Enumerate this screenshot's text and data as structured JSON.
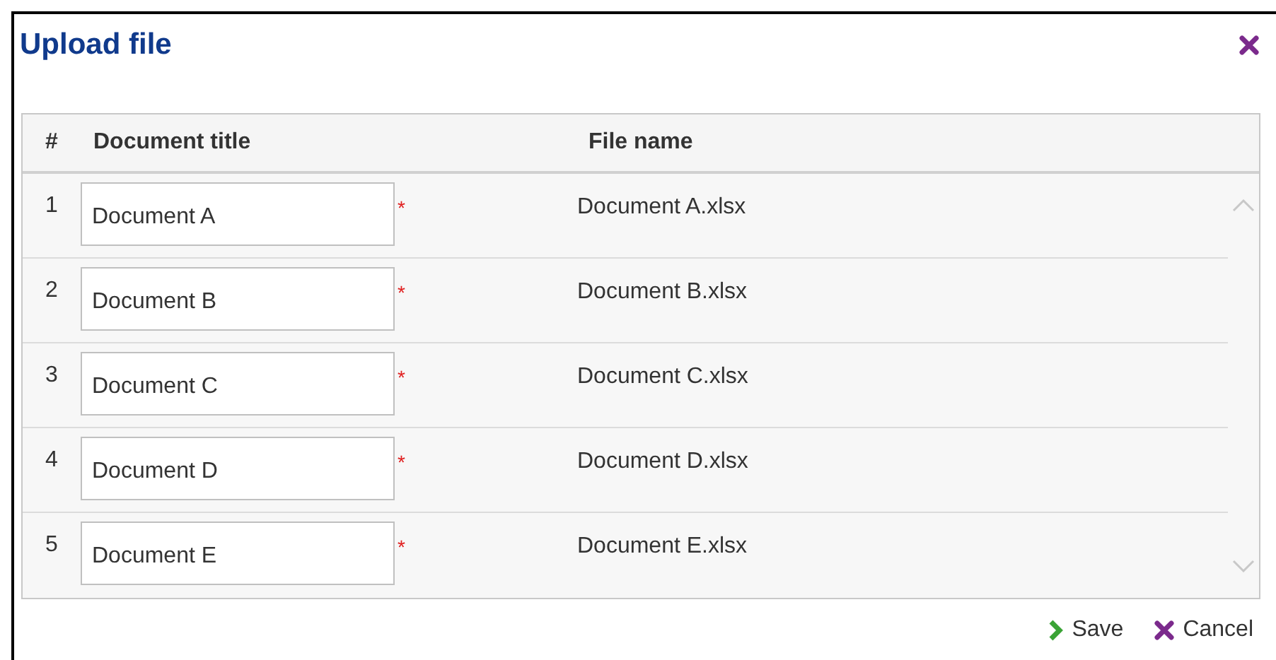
{
  "dialog": {
    "title": "Upload file"
  },
  "table": {
    "columns": [
      "#",
      "Document title",
      "File name"
    ],
    "rows": [
      {
        "number": "1",
        "title": "Document A",
        "required_mark": "*",
        "file_name": "Document A.xlsx"
      },
      {
        "number": "2",
        "title": "Document B",
        "required_mark": "*",
        "file_name": "Document B.xlsx"
      },
      {
        "number": "3",
        "title": "Document C",
        "required_mark": "*",
        "file_name": "Document C.xlsx"
      },
      {
        "number": "4",
        "title": "Document D",
        "required_mark": "*",
        "file_name": "Document D.xlsx"
      },
      {
        "number": "5",
        "title": "Document E",
        "required_mark": "*",
        "file_name": "Document E.xlsx"
      }
    ]
  },
  "buttons": [
    {
      "kind": "save",
      "label": "Save"
    },
    {
      "kind": "cancel",
      "label": "Cancel"
    }
  ]
}
